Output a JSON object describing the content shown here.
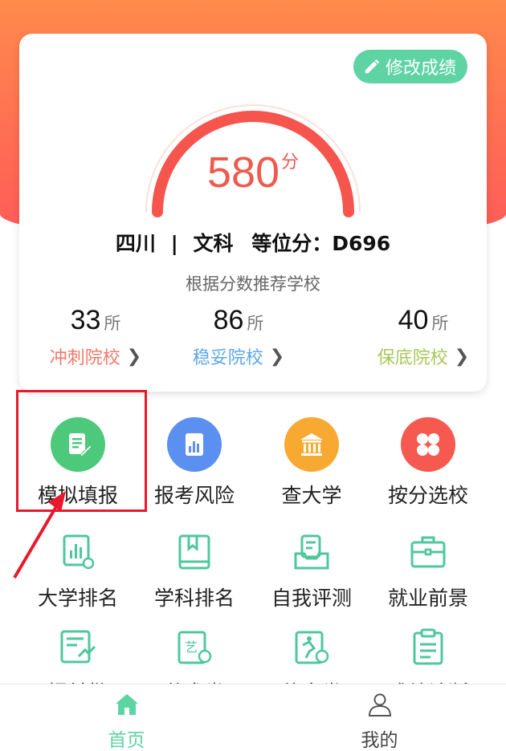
{
  "score_card": {
    "edit_label": "修改成绩",
    "score": "580",
    "score_unit": "分",
    "province": "四川",
    "separator": "|",
    "subject": "文科",
    "equiv_label": "等位分：D696",
    "recommend_text": "根据分数推荐学校",
    "gauge_fill_fraction": 1.0,
    "tiers": [
      {
        "count": "33",
        "unit": "所",
        "label": "冲刺院校",
        "color": "#f07a6a"
      },
      {
        "count": "86",
        "unit": "所",
        "label": "稳妥院校",
        "color": "#5ca7e8"
      },
      {
        "count": "40",
        "unit": "所",
        "label": "保底院校",
        "color": "#a8c85a"
      }
    ]
  },
  "features": [
    {
      "label": "模拟填报",
      "icon": "document-edit-icon",
      "color": "#4cc97a"
    },
    {
      "label": "报考风险",
      "icon": "bar-chart-icon",
      "color": "#5b8ff0"
    },
    {
      "label": "查大学",
      "icon": "university-building-icon",
      "color": "#f7a931"
    },
    {
      "label": "按分选校",
      "icon": "clover-icon",
      "color": "#f5594f"
    }
  ],
  "tools_row1": [
    {
      "label": "大学排名",
      "icon": "ranking-chart-icon"
    },
    {
      "label": "学科排名",
      "icon": "book-icon"
    },
    {
      "label": "自我评测",
      "icon": "self-test-icon"
    },
    {
      "label": "就业前景",
      "icon": "briefcase-icon"
    }
  ],
  "tools_row2": [
    {
      "label": "提前批",
      "icon": "early-batch-icon"
    },
    {
      "label": "艺术类",
      "icon": "art-palette-icon"
    },
    {
      "label": "体育类",
      "icon": "sports-icon"
    },
    {
      "label": "成绩诊断",
      "icon": "clipboard-icon"
    }
  ],
  "tool_color": "#4fc79d",
  "tabbar": {
    "home_label": "首页",
    "me_label": "我的"
  }
}
